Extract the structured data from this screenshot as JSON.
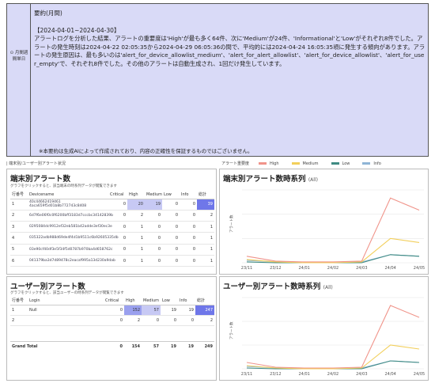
{
  "summary": {
    "side_label": "月間週間単日",
    "title": "要約(月間)",
    "period": "【2024-04-01~2024-04-30】",
    "body": "アラートログを分析した結果、アラートの重要度は'High'が最も多く64件、次に'Medium'が24件、'Informational'と'Low'がそれぞれ8件でした。アラートの発生時刻は2024-04-22 02:05:35から2024-04-29 06:05:36の間で、平均的には2024-04-24 16:05:35頃に発生する傾向があります。アラートの発生原因は、最も多いのは'alert_for_device_allowlist_medium'、'alert_for_alert_allowlist'、'alert_for_device_allowlist'、'alert_for_user_empty'で、それぞれ8件でした。その他のアラートは自動生成され、1回だけ発生しています。",
    "disclaimer": "※本要約は生成AIによって作成されており、内容の正確性を保証するものではございません。"
  },
  "header": {
    "left_label": "| 端末別/ユーザー別アラート状況"
  },
  "legend": {
    "title": "アラート重要度",
    "items": [
      {
        "label": "High",
        "color": "#f0948a"
      },
      {
        "label": "Medium",
        "color": "#f2cf5b"
      },
      {
        "label": "Low",
        "color": "#3f8b83"
      },
      {
        "label": "Info",
        "color": "#8fb5d6"
      }
    ]
  },
  "device_table": {
    "title": "端末別アラート数",
    "subtitle": "グラフをクリックすると、該当端末の時系列データが閲覧できます",
    "columns": [
      "行番号",
      "Devicename",
      "Critical",
      "High",
      "Medium",
      "Low",
      "Info",
      "総計"
    ],
    "rows": [
      {
        "no": "1",
        "name": "40c44662419461 4aca659f5d01b8b772743c8408",
        "critical": "0",
        "high": "20",
        "medium": "19",
        "low": "0",
        "info": "0",
        "total": "39"
      },
      {
        "no": "2",
        "name": "6d7f6e06f0c0f6200bff3183d7cccbc34142839b",
        "critical": "0",
        "high": "2",
        "medium": "0",
        "low": "0",
        "info": "0",
        "total": "2"
      },
      {
        "no": "3",
        "name": "0295084dc9912ef32eb581b42adde3ef30ec3e",
        "critical": "0",
        "high": "1",
        "medium": "0",
        "low": "0",
        "info": "0",
        "total": "1"
      },
      {
        "no": "4",
        "name": "035322adb988d69de4f4d1b9511c6b92605335db",
        "critical": "0",
        "high": "1",
        "medium": "0",
        "low": "0",
        "info": "0",
        "total": "1"
      },
      {
        "no": "5",
        "name": "03e90cf40df3e5f34f5d0787b970ba4d658762c",
        "critical": "0",
        "high": "1",
        "medium": "0",
        "low": "0",
        "info": "0",
        "total": "1"
      },
      {
        "no": "6",
        "name": "041379ba3d7d89478c2eacaf995a13d230a9dab",
        "critical": "0",
        "high": "1",
        "medium": "0",
        "low": "0",
        "info": "0",
        "total": "1"
      }
    ]
  },
  "user_table": {
    "title": "ユーザー別アラート数",
    "subtitle": "グラフをクリックすると、該当ユーザーの時系列データが閲覧できます",
    "columns": [
      "行番号",
      "Login",
      "Critical",
      "High",
      "Medium",
      "Low",
      "Info",
      "総計"
    ],
    "rows": [
      {
        "no": "1",
        "login": "Null",
        "critical": "0",
        "high": "152",
        "medium": "57",
        "low": "19",
        "info": "19",
        "total": "247"
      },
      {
        "no": "2",
        "login": "",
        "critical": "0",
        "high": "2",
        "medium": "0",
        "low": "0",
        "info": "0",
        "total": "2"
      }
    ],
    "grand_total": {
      "label": "Grand Total",
      "critical": "0",
      "high": "154",
      "medium": "57",
      "low": "19",
      "info": "19",
      "total": "249"
    }
  },
  "chart_data": [
    {
      "type": "line",
      "title": "端末別アラート数時系列",
      "subtitle": "(All)",
      "ylabel": "アラート数",
      "x": [
        "23/11",
        "23/12",
        "24/01",
        "24/02",
        "24/03",
        "24/04",
        "24/05"
      ],
      "ylim": [
        0,
        90
      ],
      "grid": true,
      "series": [
        {
          "name": "High",
          "color": "#f0948a",
          "values": [
            8,
            2,
            1,
            1,
            2,
            80,
            65
          ]
        },
        {
          "name": "Medium",
          "color": "#f2cf5b",
          "values": [
            4,
            1,
            0,
            0,
            1,
            30,
            25
          ]
        },
        {
          "name": "Low",
          "color": "#3f8b83",
          "values": [
            1,
            0,
            0,
            0,
            0,
            10,
            8
          ]
        },
        {
          "name": "Info",
          "color": "#8fb5d6",
          "values": [
            3,
            1,
            0,
            0,
            1,
            10,
            8
          ]
        }
      ]
    },
    {
      "type": "line",
      "title": "ユーザー別アラート数時系列",
      "subtitle": "(All)",
      "ylabel": "アラート数",
      "x": [
        "23/11",
        "23/12",
        "24/01",
        "24/02",
        "24/03",
        "24/04",
        "24/05"
      ],
      "ylim": [
        0,
        90
      ],
      "grid": true,
      "series": [
        {
          "name": "High",
          "color": "#f0948a",
          "values": [
            8,
            2,
            1,
            1,
            2,
            80,
            65
          ]
        },
        {
          "name": "Medium",
          "color": "#f2cf5b",
          "values": [
            4,
            1,
            0,
            0,
            1,
            30,
            25
          ]
        },
        {
          "name": "Low",
          "color": "#3f8b83",
          "values": [
            1,
            0,
            0,
            0,
            0,
            10,
            8
          ]
        },
        {
          "name": "Info",
          "color": "#8fb5d6",
          "values": [
            3,
            1,
            0,
            0,
            1,
            10,
            8
          ]
        }
      ]
    }
  ]
}
